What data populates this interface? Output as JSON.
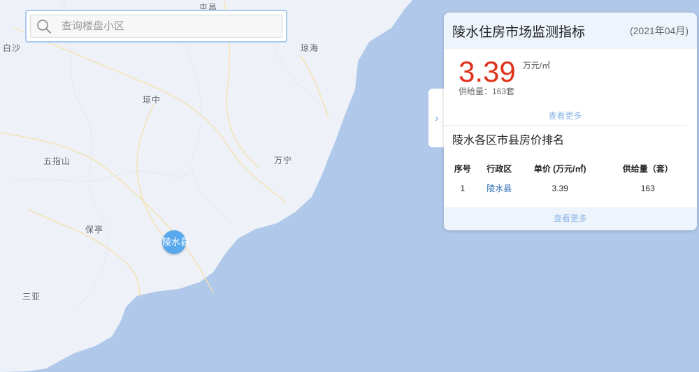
{
  "search": {
    "placeholder": "查询楼盘小区"
  },
  "map": {
    "land_color": "#eef2f8",
    "sea_color": "#b0c8ea",
    "places": [
      "屯昌",
      "白沙",
      "琼海",
      "琼中",
      "五指山",
      "万宁",
      "保亭",
      "三亚"
    ],
    "marker_label": "陵水县",
    "marker_color": "#57a8ec"
  },
  "panel": {
    "title": "陵水住房市场监测指标",
    "date": "(2021年04月)",
    "price": "3.39",
    "price_unit": "万元/㎡",
    "supply": "供给量：163套",
    "more_label": "查看更多",
    "price_color": "#e0321c",
    "expand_icon": "chevron-right-icon"
  },
  "ranking": {
    "title": "陵水各区市县房价排名",
    "headers": [
      "序号",
      "行政区",
      "单价 (万元/㎡)",
      "供给量（套）"
    ],
    "rows": [
      {
        "no": "1",
        "district": "陵水县",
        "price": "3.39",
        "supply": "163"
      }
    ],
    "more_label": "查看更多"
  }
}
